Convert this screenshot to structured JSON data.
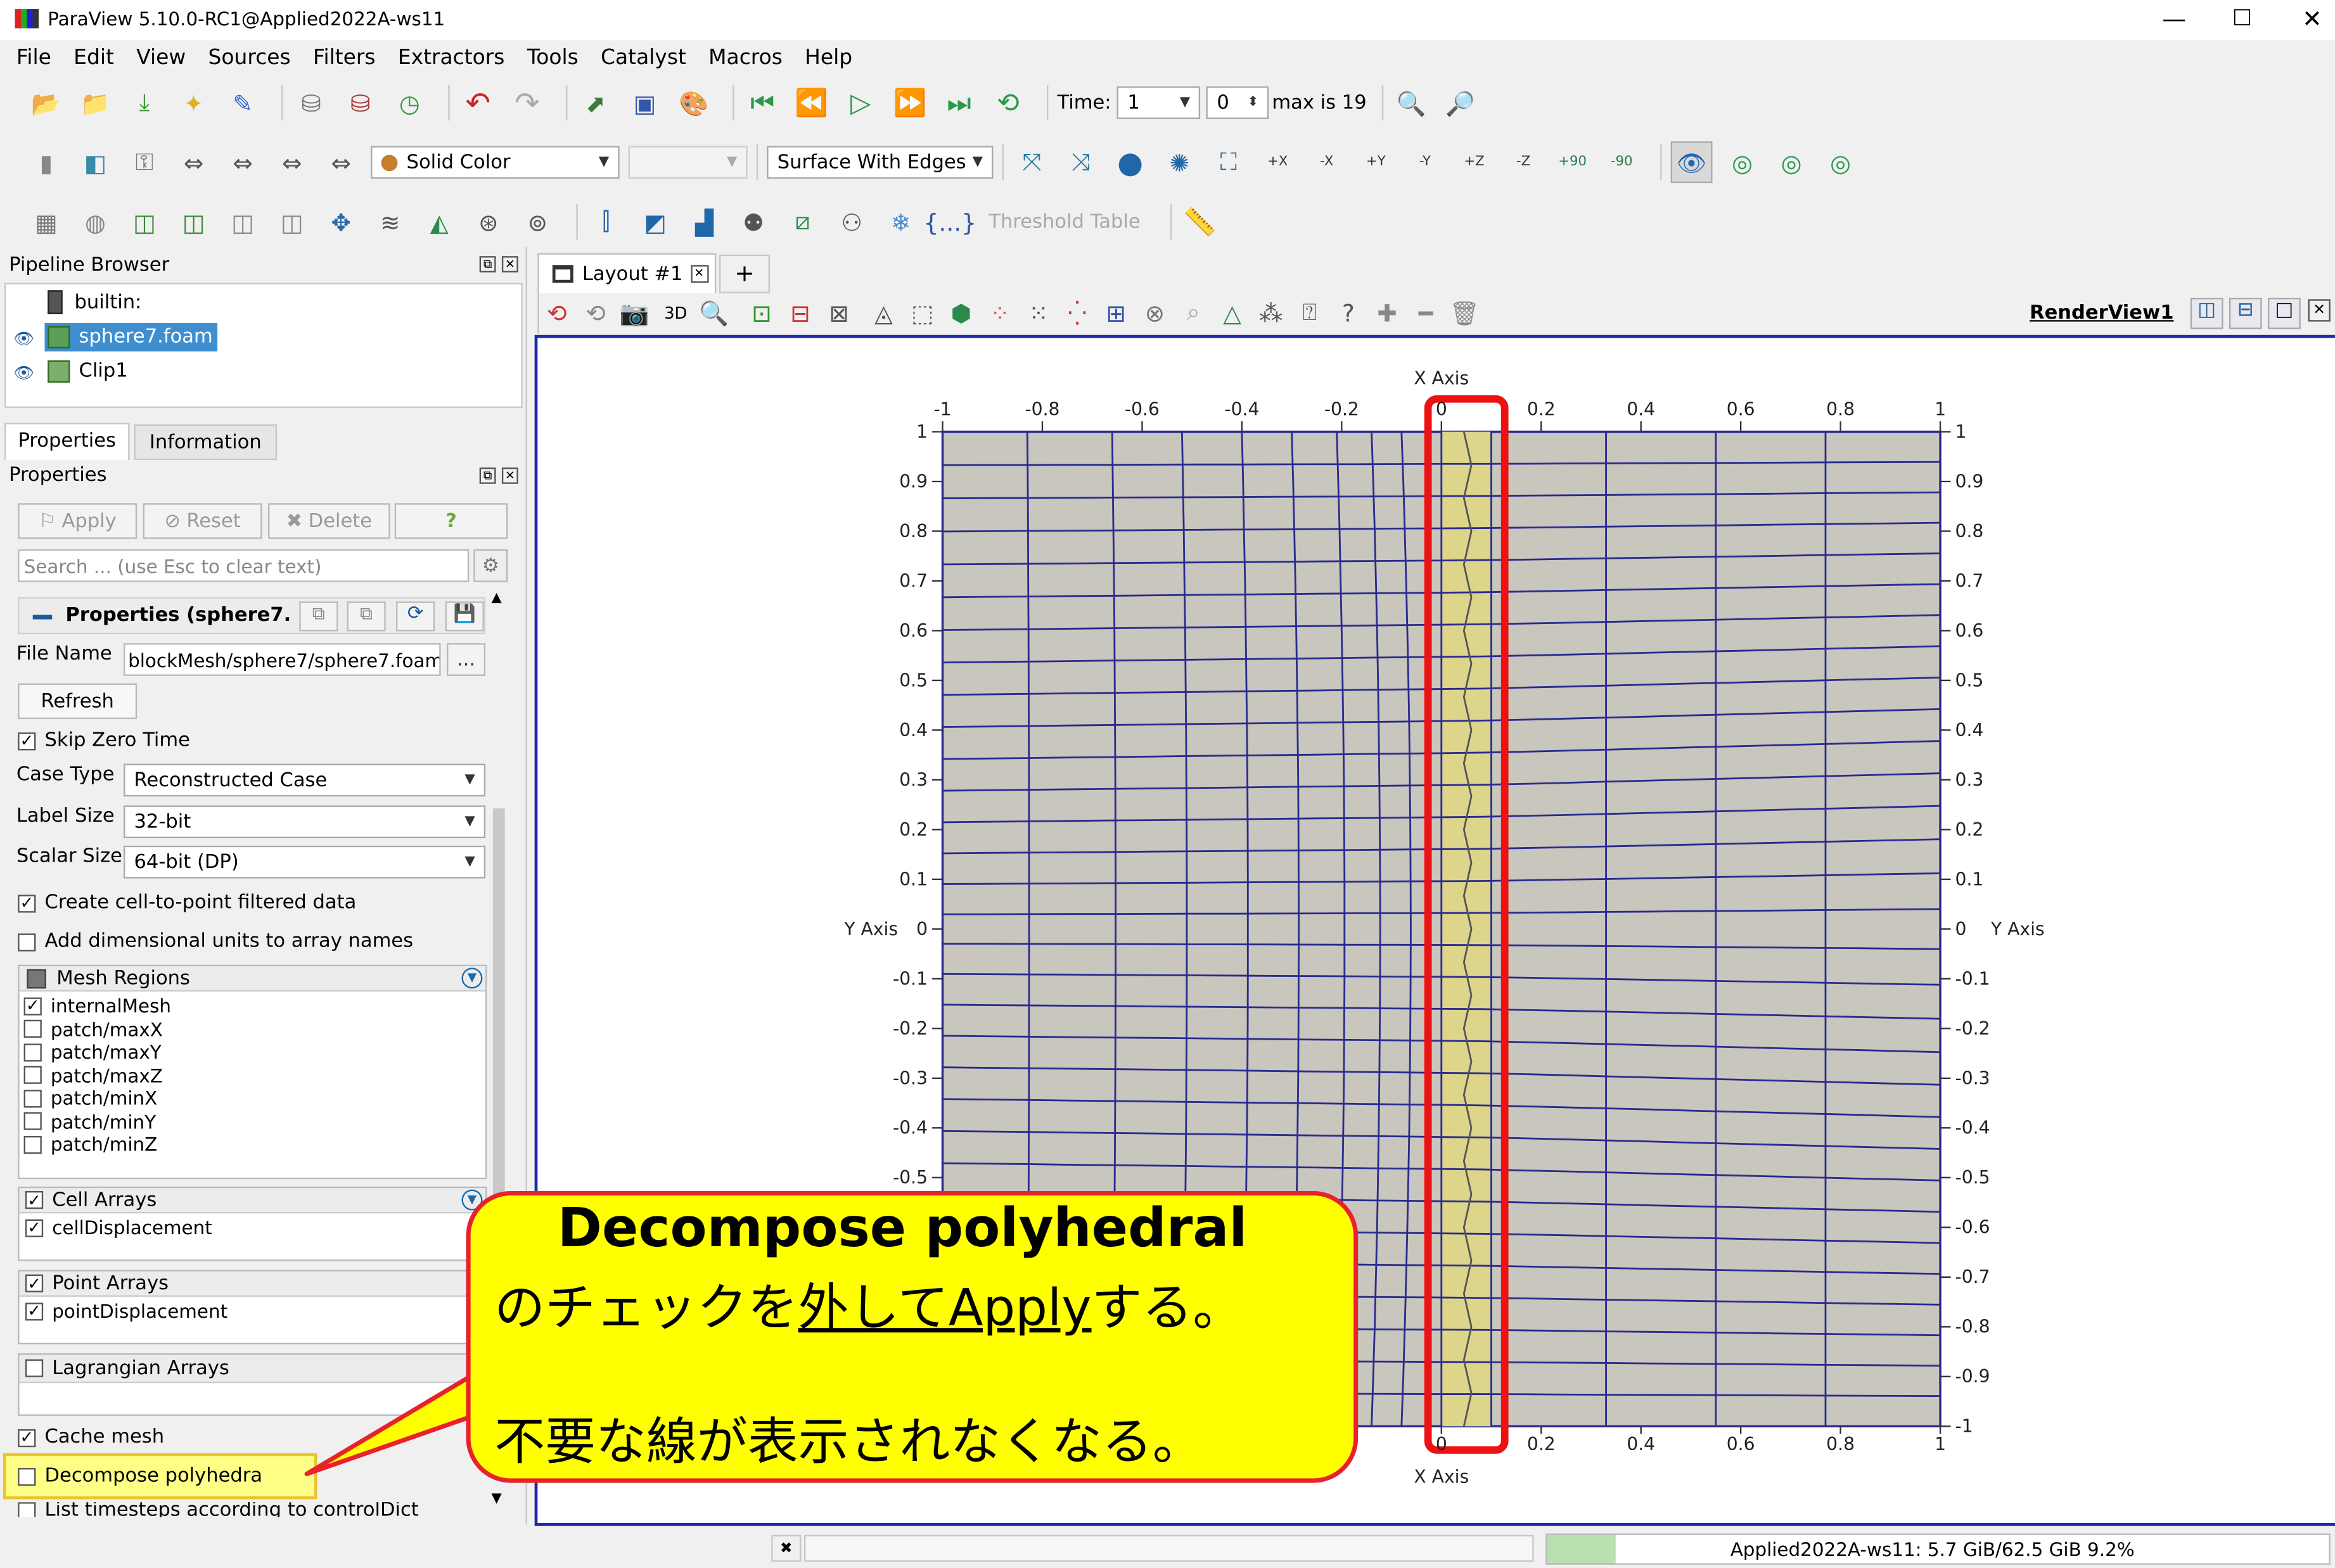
{
  "window": {
    "title": "ParaView 5.10.0-RC1@Applied2022A-ws11",
    "controls": [
      "—",
      "☐",
      "✕"
    ]
  },
  "menu": [
    "File",
    "Edit",
    "View",
    "Sources",
    "Filters",
    "Extractors",
    "Tools",
    "Catalyst",
    "Macros",
    "Help"
  ],
  "toolbar1": {
    "time_label": "Time:",
    "time_value": "1",
    "index_value": "0",
    "max_text": "max is 19"
  },
  "toolbar2": {
    "color_by": "Solid Color",
    "component": "",
    "representation": "Surface With Edges",
    "view_labels": [
      "+X",
      "-X",
      "+Y",
      "-Y",
      "+Z",
      "-Z",
      "+90",
      "-90"
    ]
  },
  "toolbar3": {
    "threshold_table": "Threshold Table"
  },
  "pipeline": {
    "title": "Pipeline Browser",
    "items": [
      {
        "label": "builtin:",
        "selected": false
      },
      {
        "label": "sphere7.foam",
        "selected": true
      },
      {
        "label": "Clip1",
        "selected": false
      }
    ]
  },
  "tabs": {
    "properties": "Properties",
    "information": "Information"
  },
  "properties": {
    "panel_title": "Properties",
    "apply": "Apply",
    "reset": "Reset",
    "delete": "Delete",
    "help": "?",
    "search_placeholder": "Search ... (use Esc to clear text)",
    "section_title": "Properties (sphere7.",
    "file_name_label": "File Name",
    "file_name_value": "blockMesh/sphere7/sphere7.foam",
    "browse": "...",
    "refresh": "Refresh",
    "skip_zero_time": "Skip Zero Time",
    "case_type_label": "Case Type",
    "case_type_value": "Reconstructed Case",
    "label_size_label": "Label Size",
    "label_size_value": "32-bit",
    "scalar_size_label": "Scalar Size",
    "scalar_size_value": "64-bit (DP)",
    "create_cell_to_point": "Create cell-to-point filtered data",
    "add_dim_units": "Add dimensional units to array names",
    "mesh_regions_header": "Mesh Regions",
    "mesh_regions": [
      {
        "label": "internalMesh",
        "checked": true
      },
      {
        "label": "patch/maxX",
        "checked": false
      },
      {
        "label": "patch/maxY",
        "checked": false
      },
      {
        "label": "patch/maxZ",
        "checked": false
      },
      {
        "label": "patch/minX",
        "checked": false
      },
      {
        "label": "patch/minY",
        "checked": false
      },
      {
        "label": "patch/minZ",
        "checked": false
      }
    ],
    "cell_arrays_header": "Cell Arrays",
    "cell_arrays": [
      "cellDisplacement"
    ],
    "point_arrays_header": "Point Arrays",
    "point_arrays": [
      "pointDisplacement"
    ],
    "lagrangian_header": "Lagrangian Arrays",
    "cache_mesh": "Cache mesh",
    "decompose_polyhedra": "Decompose polyhedra",
    "list_timesteps": "List timesteps according to controlDict"
  },
  "layout": {
    "tab_label": "Layout #1",
    "add_tab": "+",
    "view_name": "RenderView1",
    "mode_3d": "3D"
  },
  "render": {
    "x_axis_title": "X Axis",
    "y_axis_title": "Y Axis",
    "x_ticks": [
      "-1",
      "-0.8",
      "-0.6",
      "-0.4",
      "-0.2",
      "0",
      "0.2",
      "0.4",
      "0.6",
      "0.8",
      "1"
    ],
    "y_ticks": [
      "1",
      "0.9",
      "0.8",
      "0.7",
      "0.6",
      "0.5",
      "0.4",
      "0.3",
      "0.2",
      "0.1",
      "0",
      "-0.1",
      "-0.2",
      "-0.3",
      "-0.4",
      "-0.5",
      "-0.6",
      "-0.7",
      "-0.8",
      "-0.9",
      "-1"
    ],
    "mesh_color": "#2b2b8f",
    "fill_color": "#c9c6bd",
    "highlight_color": "#dcd58a",
    "highlight_border": "#ee1111"
  },
  "callout": {
    "line1": "Decompose polyhedral",
    "line2_pre": "のチェックを",
    "line2_ul": "外してApply",
    "line2_post": "する。",
    "line3": "不要な線が表示されなくなる。",
    "bg": "#ffff00",
    "border": "#e8222a"
  },
  "status": {
    "text": "Applied2022A-ws11: 5.7 GiB/62.5 GiB 9.2%",
    "close": "✖"
  }
}
